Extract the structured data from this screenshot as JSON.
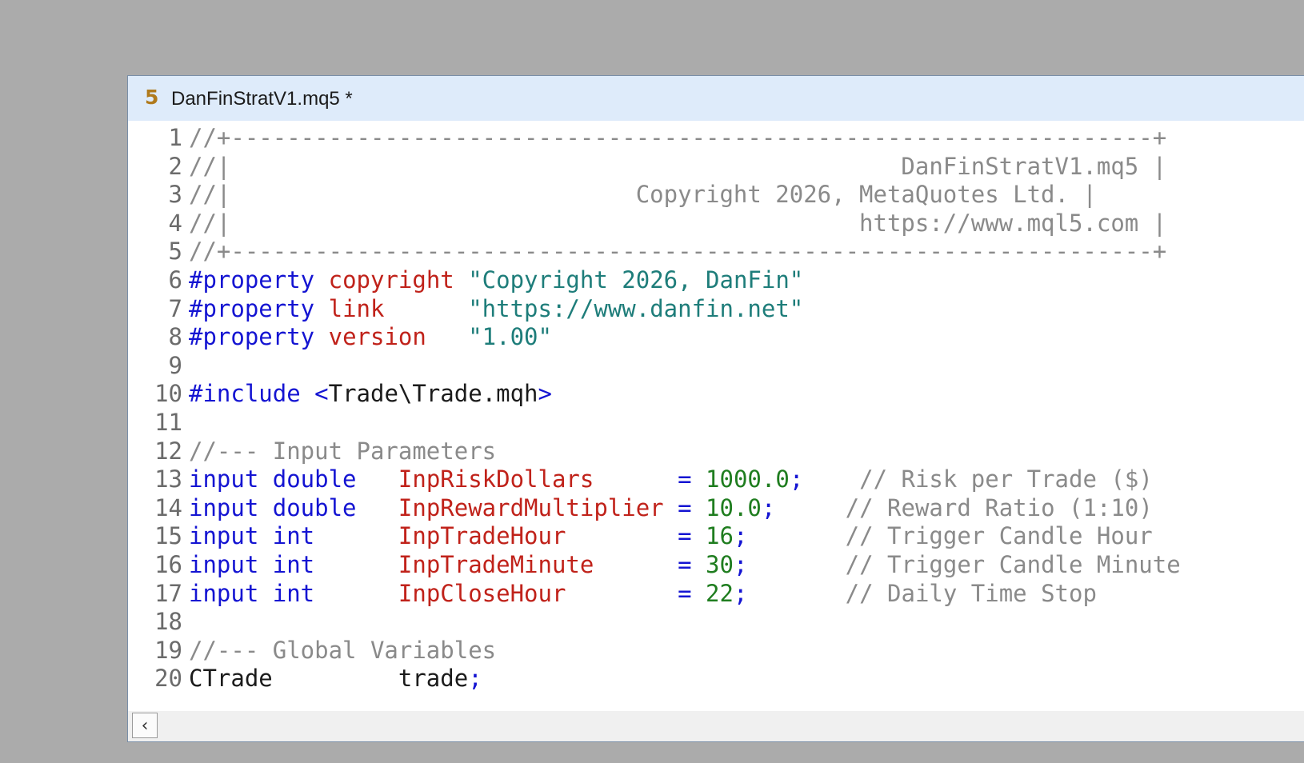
{
  "tab": {
    "icon_glyph": "5",
    "title": "DanFinStratV1.mq5 *"
  },
  "code_lines": [
    {
      "n": "1",
      "tokens": [
        {
          "c": "com",
          "t": "//+------------------------------------------------------------------+"
        }
      ]
    },
    {
      "n": "2",
      "tokens": [
        {
          "c": "com",
          "t": "//|                                                DanFinStratV1.mq5 |"
        }
      ]
    },
    {
      "n": "3",
      "tokens": [
        {
          "c": "com",
          "t": "//|                             Copyright 2026, MetaQuotes Ltd. |"
        }
      ]
    },
    {
      "n": "4",
      "tokens": [
        {
          "c": "com",
          "t": "//|                                             https://www.mql5.com |"
        }
      ]
    },
    {
      "n": "5",
      "tokens": [
        {
          "c": "com",
          "t": "//+------------------------------------------------------------------+"
        }
      ]
    },
    {
      "n": "6",
      "tokens": [
        {
          "c": "kw",
          "t": "#property "
        },
        {
          "c": "id",
          "t": "copyright"
        },
        {
          "c": "txt",
          "t": " "
        },
        {
          "c": "str",
          "t": "\"Copyright 2026, DanFin\""
        }
      ]
    },
    {
      "n": "7",
      "tokens": [
        {
          "c": "kw",
          "t": "#property "
        },
        {
          "c": "id",
          "t": "link"
        },
        {
          "c": "txt",
          "t": "      "
        },
        {
          "c": "str",
          "t": "\"https://www.danfin.net\""
        }
      ]
    },
    {
      "n": "8",
      "tokens": [
        {
          "c": "kw",
          "t": "#property "
        },
        {
          "c": "id",
          "t": "version"
        },
        {
          "c": "txt",
          "t": "   "
        },
        {
          "c": "str",
          "t": "\"1.00\""
        }
      ]
    },
    {
      "n": "9",
      "tokens": []
    },
    {
      "n": "10",
      "tokens": [
        {
          "c": "kw",
          "t": "#include "
        },
        {
          "c": "ang",
          "t": "<"
        },
        {
          "c": "inc",
          "t": "Trade\\Trade.mqh"
        },
        {
          "c": "ang",
          "t": ">"
        }
      ]
    },
    {
      "n": "11",
      "tokens": []
    },
    {
      "n": "12",
      "tokens": [
        {
          "c": "com",
          "t": "//--- Input Parameters"
        }
      ]
    },
    {
      "n": "13",
      "tokens": [
        {
          "c": "kw",
          "t": "input double"
        },
        {
          "c": "txt",
          "t": "   "
        },
        {
          "c": "id",
          "t": "InpRiskDollars"
        },
        {
          "c": "txt",
          "t": "      "
        },
        {
          "c": "kw",
          "t": "="
        },
        {
          "c": "txt",
          "t": " "
        },
        {
          "c": "num",
          "t": "1000.0"
        },
        {
          "c": "kw",
          "t": ";"
        },
        {
          "c": "txt",
          "t": "    "
        },
        {
          "c": "com",
          "t": "// Risk per Trade ($)"
        }
      ]
    },
    {
      "n": "14",
      "tokens": [
        {
          "c": "kw",
          "t": "input double"
        },
        {
          "c": "txt",
          "t": "   "
        },
        {
          "c": "id",
          "t": "InpRewardMultiplier"
        },
        {
          "c": "txt",
          "t": " "
        },
        {
          "c": "kw",
          "t": "="
        },
        {
          "c": "txt",
          "t": " "
        },
        {
          "c": "num",
          "t": "10.0"
        },
        {
          "c": "kw",
          "t": ";"
        },
        {
          "c": "txt",
          "t": "     "
        },
        {
          "c": "com",
          "t": "// Reward Ratio (1:10)"
        }
      ]
    },
    {
      "n": "15",
      "tokens": [
        {
          "c": "kw",
          "t": "input int"
        },
        {
          "c": "txt",
          "t": "      "
        },
        {
          "c": "id",
          "t": "InpTradeHour"
        },
        {
          "c": "txt",
          "t": "        "
        },
        {
          "c": "kw",
          "t": "="
        },
        {
          "c": "txt",
          "t": " "
        },
        {
          "c": "num",
          "t": "16"
        },
        {
          "c": "kw",
          "t": ";"
        },
        {
          "c": "txt",
          "t": "       "
        },
        {
          "c": "com",
          "t": "// Trigger Candle Hour"
        }
      ]
    },
    {
      "n": "16",
      "tokens": [
        {
          "c": "kw",
          "t": "input int"
        },
        {
          "c": "txt",
          "t": "      "
        },
        {
          "c": "id",
          "t": "InpTradeMinute"
        },
        {
          "c": "txt",
          "t": "      "
        },
        {
          "c": "kw",
          "t": "="
        },
        {
          "c": "txt",
          "t": " "
        },
        {
          "c": "num",
          "t": "30"
        },
        {
          "c": "kw",
          "t": ";"
        },
        {
          "c": "txt",
          "t": "       "
        },
        {
          "c": "com",
          "t": "// Trigger Candle Minute"
        }
      ]
    },
    {
      "n": "17",
      "tokens": [
        {
          "c": "kw",
          "t": "input int"
        },
        {
          "c": "txt",
          "t": "      "
        },
        {
          "c": "id",
          "t": "InpCloseHour"
        },
        {
          "c": "txt",
          "t": "        "
        },
        {
          "c": "kw",
          "t": "="
        },
        {
          "c": "txt",
          "t": " "
        },
        {
          "c": "num",
          "t": "22"
        },
        {
          "c": "kw",
          "t": ";"
        },
        {
          "c": "txt",
          "t": "       "
        },
        {
          "c": "com",
          "t": "// Daily Time Stop"
        }
      ]
    },
    {
      "n": "18",
      "tokens": []
    },
    {
      "n": "19",
      "tokens": [
        {
          "c": "com",
          "t": "//--- Global Variables"
        }
      ]
    },
    {
      "n": "20",
      "tokens": [
        {
          "c": "txt",
          "t": "CTrade         trade"
        },
        {
          "c": "kw",
          "t": ";"
        }
      ]
    }
  ],
  "scrollbar": {
    "left_arrow_glyph": "‹"
  }
}
